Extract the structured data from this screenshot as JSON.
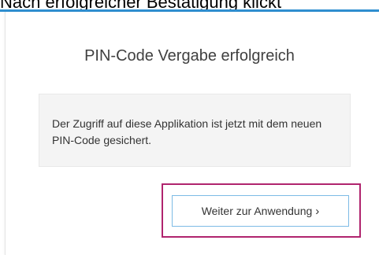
{
  "caption": {
    "text": "Nach erfolgreicher Bestätigung klickt"
  },
  "dialog": {
    "title": "PIN-Code Vergabe erfolgreich",
    "message": "Der Zugriff auf diese Applikation ist jetzt mit dem neuen PIN-Code gesichert.",
    "continue_label": "Weiter zur Anwendung",
    "continue_icon": "chevron-right-icon"
  },
  "colors": {
    "accent_bar": "#2f8fd0",
    "highlight_frame": "#b0246e",
    "button_border": "#7dbbe5",
    "message_background": "#f4f4f4"
  }
}
